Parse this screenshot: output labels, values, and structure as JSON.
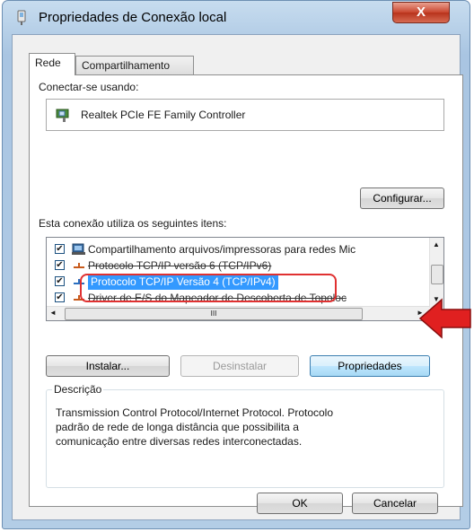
{
  "window": {
    "title": "Propriedades de Conexão local",
    "close_label": "X"
  },
  "tabs": [
    {
      "label": "Rede",
      "selected": true
    },
    {
      "label": "Compartilhamento",
      "selected": false
    }
  ],
  "connect_using": {
    "label": "Conectar-se usando:",
    "adapter": "Realtek PCIe FE Family Controller",
    "configure_label": "Configurar..."
  },
  "items": {
    "label": "Esta conexão utiliza os seguintes itens:",
    "list": [
      {
        "label": "Compartilhamento arquivos/impressoras para redes Mic",
        "checked": true
      },
      {
        "label": "Protocolo TCP/IP versão 6 (TCP/IPv6)",
        "checked": true
      },
      {
        "label": "Protocolo TCP/IP Versão 4 (TCP/IPv4)",
        "checked": true,
        "selected": true
      },
      {
        "label": "Driver de E/S do Mapeador de Descoberta de Topoloc",
        "checked": true
      }
    ],
    "hscroll_grip": "III"
  },
  "buttons": {
    "install": "Instalar...",
    "uninstall": "Desinstalar",
    "properties": "Propriedades",
    "ok": "OK",
    "cancel": "Cancelar"
  },
  "description": {
    "label": "Descrição",
    "text_line1": "Transmission Control Protocol/Internet Protocol. Protocolo",
    "text_line2": "padrão de rede de longa distância que possibilita a",
    "text_line3": "comunicação entre diversas redes interconectadas."
  },
  "colors": {
    "selection": "#3399ff",
    "annotation_red": "#e03131"
  }
}
